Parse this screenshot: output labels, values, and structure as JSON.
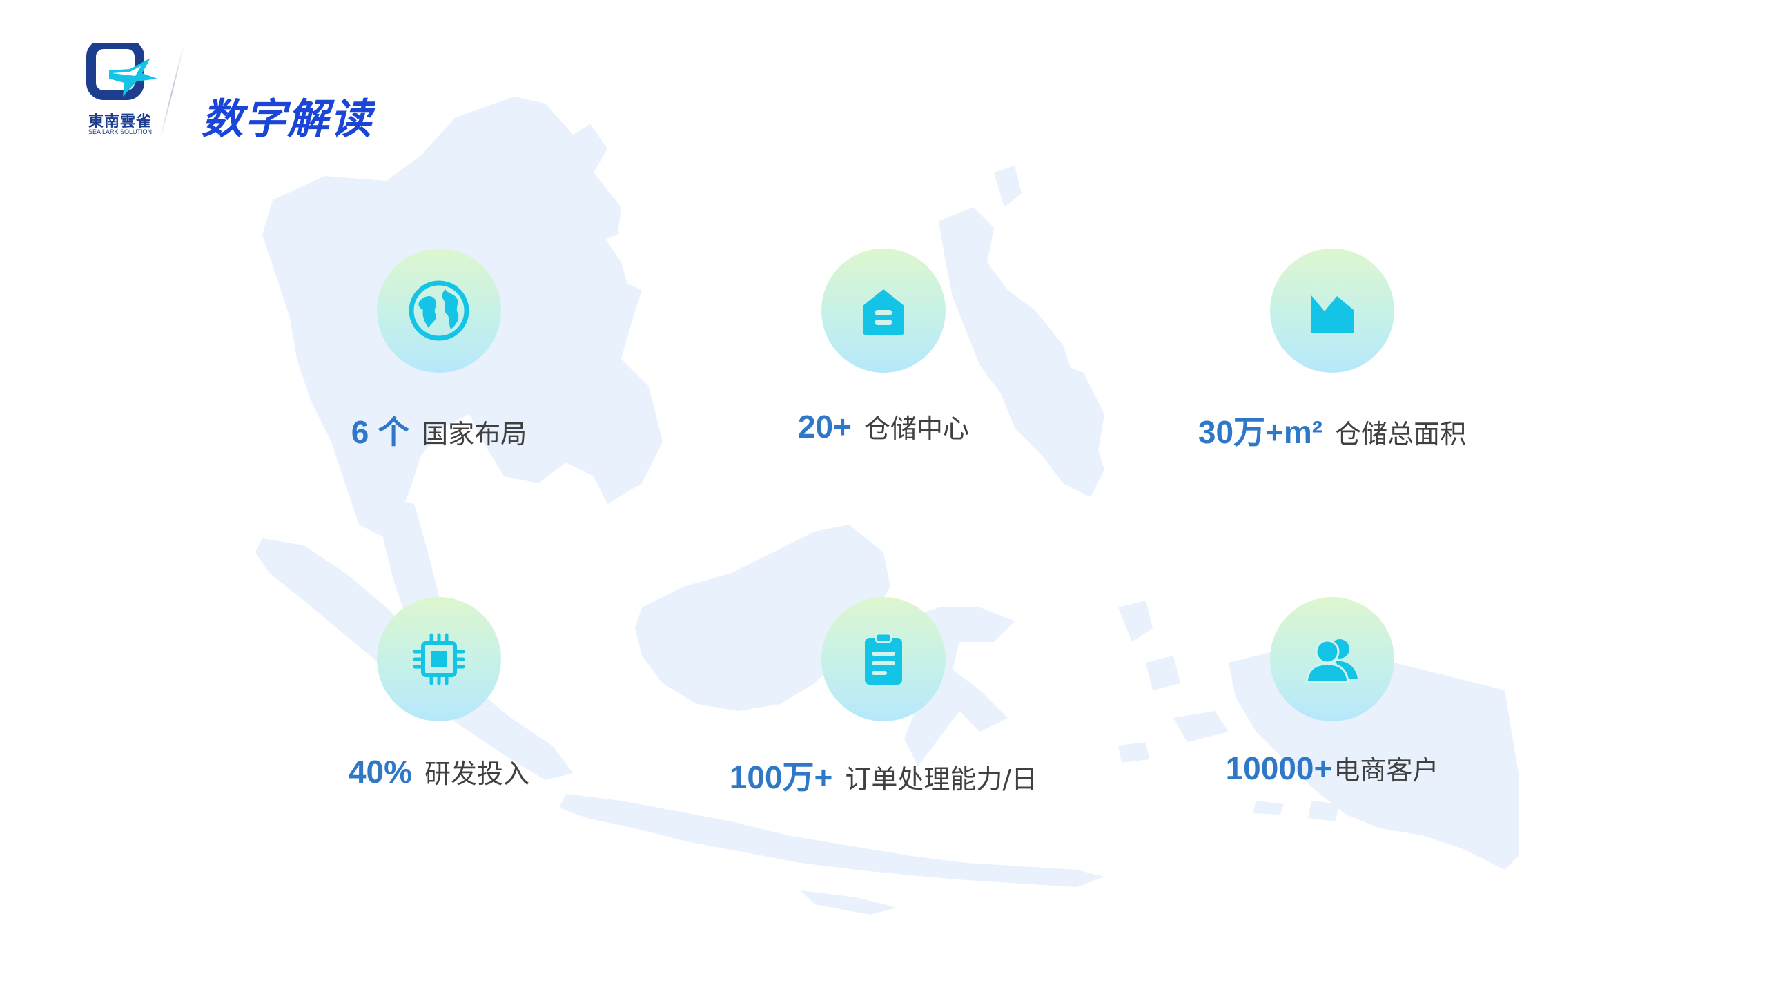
{
  "header": {
    "logo_cn": "東南雲雀",
    "logo_en": "SEA LARK SOLUTION",
    "title": "数字解读"
  },
  "colors": {
    "brand_blue": "#1a45d6",
    "number_blue": "#2e78c7",
    "icon_cyan": "#13c4e6",
    "label_gray": "#404040",
    "map_fill": "#e8f1fc"
  },
  "stats": [
    {
      "number": "6 个",
      "label": "国家布局",
      "icon": "globe-icon"
    },
    {
      "number": "20+",
      "label": "仓储中心",
      "icon": "warehouse-icon"
    },
    {
      "number": "30万+m²",
      "label": "仓储总面积",
      "icon": "area-chart-icon"
    },
    {
      "number": "40%",
      "label": "研发投入",
      "icon": "chip-icon"
    },
    {
      "number": "100万+",
      "label": "订单处理能力/日",
      "icon": "clipboard-icon"
    },
    {
      "number": "10000+",
      "label": "电商客户",
      "icon": "users-icon"
    }
  ]
}
